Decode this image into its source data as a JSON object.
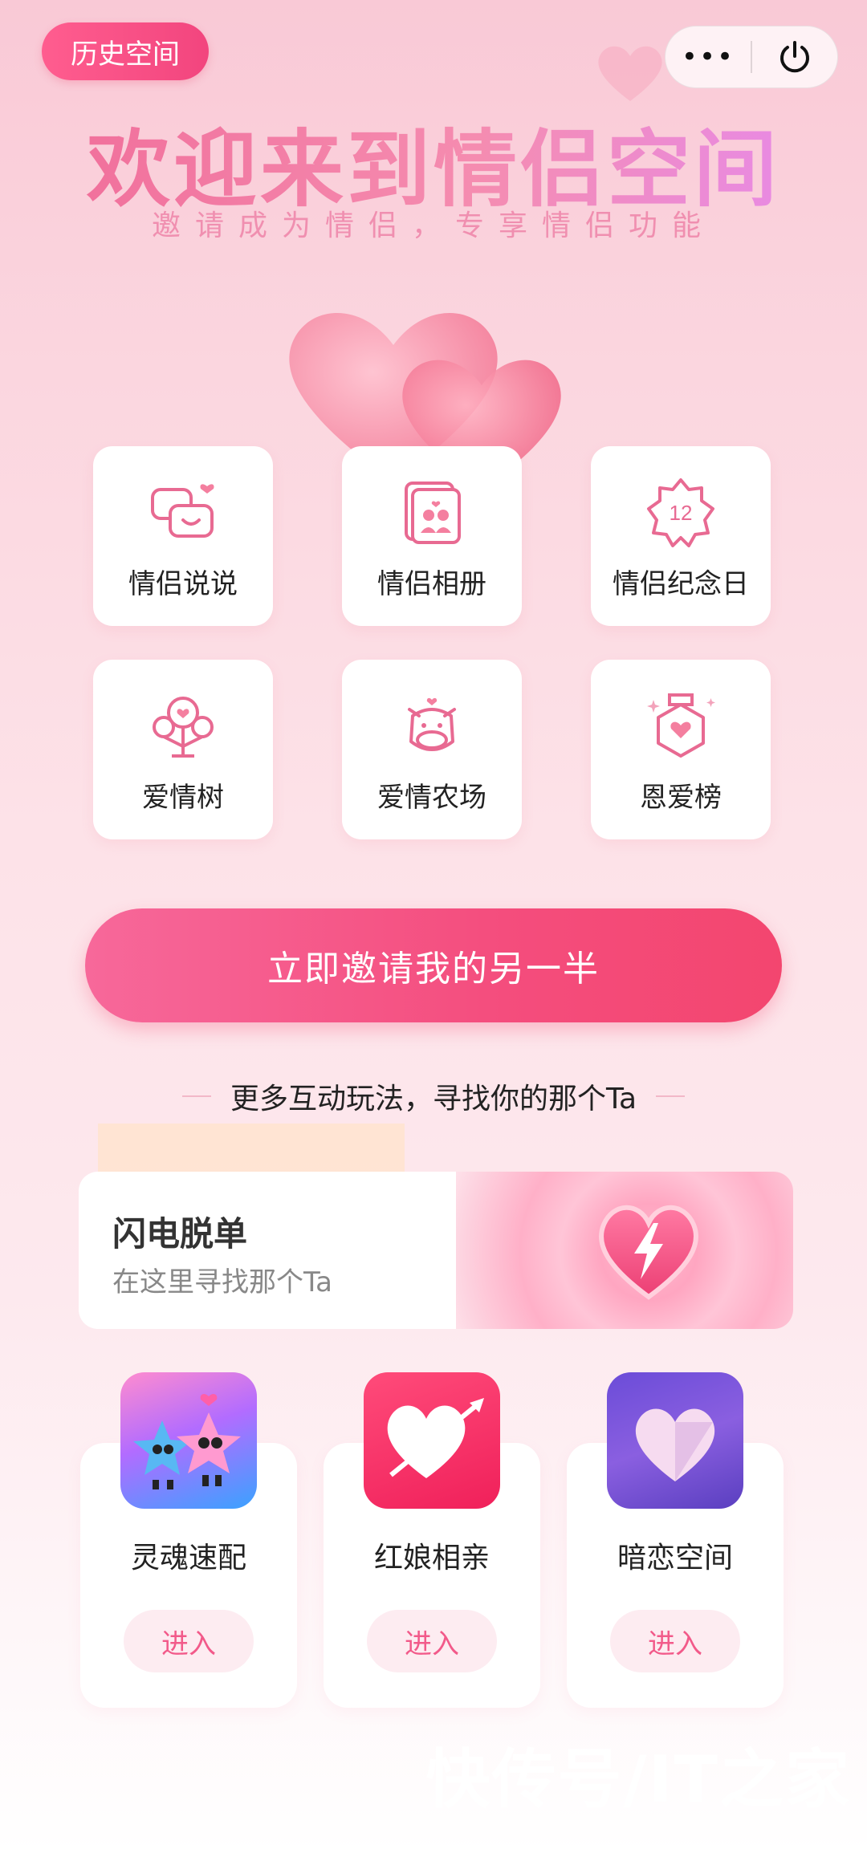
{
  "header": {
    "history_label": "历史空间",
    "more_icon": "•••",
    "power_icon": "⏻"
  },
  "hero": {
    "title": "欢迎来到情侣空间",
    "subtitle": "邀请成为情侣，专享情侣功能"
  },
  "features": [
    {
      "label": "情侣说说",
      "icon": "chat-bubbles-icon"
    },
    {
      "label": "情侣相册",
      "icon": "photo-album-icon"
    },
    {
      "label": "情侣纪念日",
      "icon": "anniversary-badge-icon",
      "badge": "12"
    },
    {
      "label": "爱情树",
      "icon": "love-tree-icon"
    },
    {
      "label": "爱情农场",
      "icon": "cow-farm-icon"
    },
    {
      "label": "恩爱榜",
      "icon": "medal-icon"
    }
  ],
  "invite": {
    "label": "立即邀请我的另一半"
  },
  "more_section": {
    "label": "更多互动玩法，寻找你的那个Ta"
  },
  "flash": {
    "title": "闪电脱单",
    "subtitle": "在这里寻找那个Ta"
  },
  "games": [
    {
      "name": "灵魂速配",
      "enter": "进入"
    },
    {
      "name": "红娘相亲",
      "enter": "进入"
    },
    {
      "name": "暗恋空间",
      "enter": "进入"
    }
  ],
  "watermark": "快传号/IT之家",
  "colors": {
    "accent": "#f44d7d",
    "icon_pink": "#e86a92",
    "bg_top": "#f9c9d6"
  }
}
